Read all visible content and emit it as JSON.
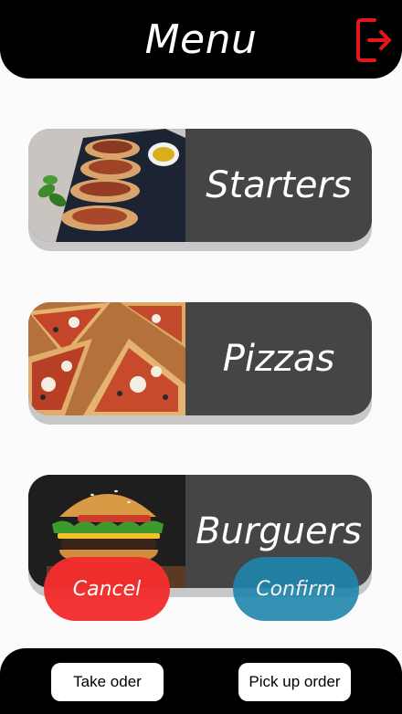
{
  "header": {
    "title": "Menu",
    "logout_icon": "logout-icon",
    "logout_color": "#e8141c"
  },
  "categories": [
    {
      "label": "Starters",
      "image": "bruschetta-photo"
    },
    {
      "label": "Pizzas",
      "image": "pizza-photo"
    },
    {
      "label": "Burguers",
      "image": "burger-photo"
    }
  ],
  "actions": {
    "cancel_label": "Cancel",
    "cancel_color": "#f32e2e",
    "confirm_label": "Confirm",
    "confirm_color": "#1f86ad"
  },
  "footer": {
    "take_order_label": "Take oder",
    "pick_up_label": "Pick up order"
  }
}
